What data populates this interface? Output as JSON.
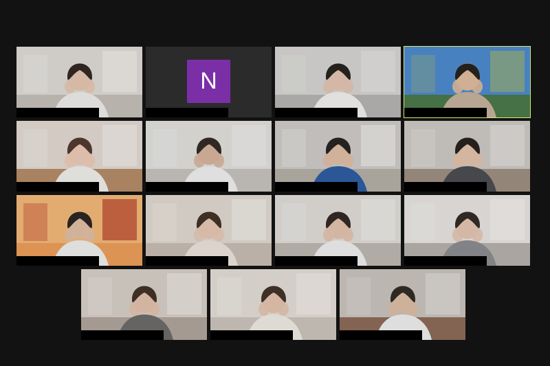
{
  "meeting": {
    "tiles": [
      {
        "id": "t1",
        "kind": "video",
        "bg": "#c7c2bb",
        "wall": "#e3dfda",
        "accent": "#f4f1ed",
        "skin": "#e9c9b3",
        "hair": "#2a221d",
        "shirt": "#f1efed"
      },
      {
        "id": "t2",
        "kind": "avatar",
        "avatar_letter": "N",
        "avatar_color": "#7b2fa6"
      },
      {
        "id": "t3",
        "kind": "video",
        "bg": "#b9b7b6",
        "wall": "#d9d8d7",
        "accent": "#e8e7e5",
        "skin": "#e6c7b5",
        "hair": "#1f1b18",
        "shirt": "#f5f4f2"
      },
      {
        "id": "t4",
        "kind": "video",
        "bg": "#4d7a4b",
        "wall": "#4f8ed8",
        "accent": "#a2b46e",
        "skin": "#e2be9f",
        "hair": "#1e1a17",
        "shirt": "#c9b59f",
        "active": true
      },
      {
        "id": "t5",
        "kind": "video",
        "bg": "#b88e6a",
        "wall": "#e6e0da",
        "accent": "#f3f0ec",
        "skin": "#efcdb9",
        "hair": "#4a3329",
        "shirt": "#f3f1ee"
      },
      {
        "id": "t6",
        "kind": "video",
        "bg": "#c9c6c2",
        "wall": "#e6e5e2",
        "accent": "#f1f0ee",
        "skin": "#d9b7a0",
        "hair": "#2a2420",
        "shirt": "#f2f2f2"
      },
      {
        "id": "t7",
        "kind": "video",
        "bg": "#b7b2aa",
        "wall": "#d2d0cc",
        "accent": "#f0efec",
        "skin": "#e2c1a7",
        "hair": "#1f1c1a",
        "shirt": "#2f5fa4"
      },
      {
        "id": "t8",
        "kind": "video",
        "bg": "#a09283",
        "wall": "#d3cfca",
        "accent": "#e7e4e0",
        "skin": "#e6c5ad",
        "hair": "#1e1a18",
        "shirt": "#4c4f52"
      },
      {
        "id": "t9",
        "kind": "video",
        "bg": "#f0a05b",
        "wall": "#f5bd7c",
        "accent": "#b73c2a",
        "skin": "#e3c2a7",
        "hair": "#231f1d",
        "shirt": "#f1f1ef"
      },
      {
        "id": "t10",
        "kind": "video",
        "bg": "#cbbfb6",
        "wall": "#e4ddd6",
        "accent": "#f3efe9",
        "skin": "#e9cab6",
        "hair": "#3a2a22",
        "shirt": "#efe7de"
      },
      {
        "id": "t11",
        "kind": "video",
        "bg": "#c0bab4",
        "wall": "#e5e2de",
        "accent": "#f1efec",
        "skin": "#e5c5b0",
        "hair": "#2a2220",
        "shirt": "#f1f1f1"
      },
      {
        "id": "t12",
        "kind": "video",
        "bg": "#b9b4ae",
        "wall": "#ece9e6",
        "accent": "#f7f5f2",
        "skin": "#e7c8b4",
        "hair": "#2a2421",
        "shirt": "#8e8f92"
      },
      {
        "id": "t13",
        "kind": "video",
        "bg": "#b2a89e",
        "wall": "#dcd4cc",
        "accent": "#eeeae4",
        "skin": "#e5c4ae",
        "hair": "#3b2b22",
        "shirt": "#6f6d6c"
      },
      {
        "id": "t14",
        "kind": "video",
        "bg": "#cfc7bf",
        "wall": "#e7e2dc",
        "accent": "#f4f0ea",
        "skin": "#e6c6b1",
        "hair": "#3b2c24",
        "shirt": "#f1eee8"
      },
      {
        "id": "t15",
        "kind": "video",
        "bg": "#8f6d59",
        "wall": "#d0cbc6",
        "accent": "#e4e0dc",
        "skin": "#e0c0a8",
        "hair": "#2a2521",
        "shirt": "#f1f1f1"
      }
    ]
  }
}
